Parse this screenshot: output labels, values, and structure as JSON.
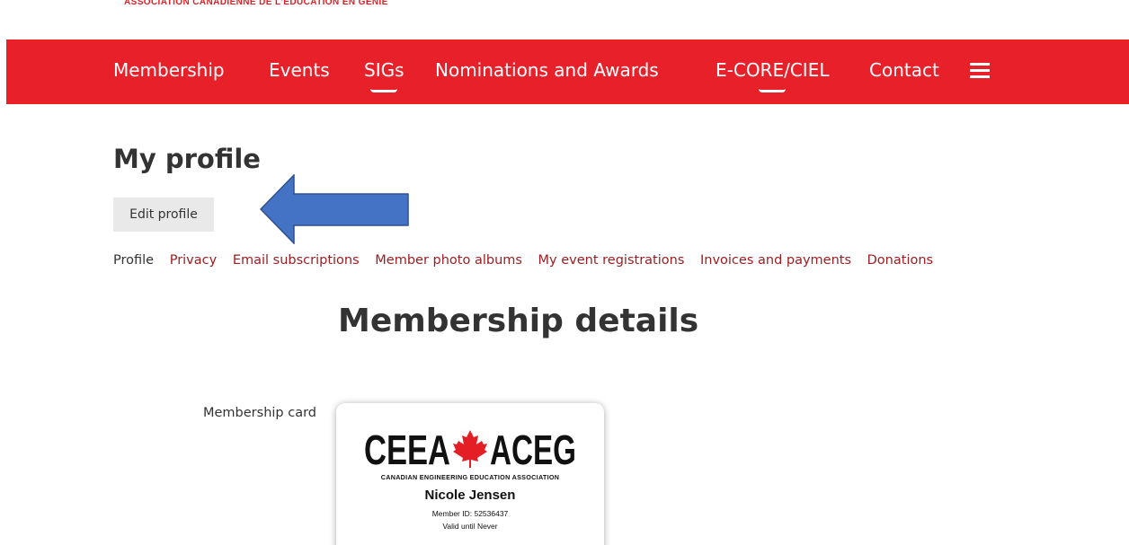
{
  "header": {
    "org_tagline": "ASSOCIATION CANADIENNE DE L'EDUCATION EN GENIE"
  },
  "nav": {
    "items": [
      {
        "label": "Membership",
        "active": false
      },
      {
        "label": "Events",
        "active": false
      },
      {
        "label": "SIGs",
        "active": true
      },
      {
        "label": "Nominations and Awards",
        "active": false
      },
      {
        "label": "E-CORE/CIEL",
        "active": true
      },
      {
        "label": "Contact",
        "active": false
      }
    ],
    "menu_icon": "hamburger-icon",
    "color": "#e8202a"
  },
  "profile": {
    "title": "My profile",
    "edit_button": "Edit profile",
    "annotation": "arrow-icon",
    "annotation_color": "#4472c4"
  },
  "subnav": {
    "current": "Profile",
    "links": [
      "Privacy",
      "Email subscriptions",
      "Member photo albums",
      "My event registrations",
      "Invoices and payments",
      "Donations"
    ],
    "link_color": "#9b1c1f"
  },
  "membership": {
    "title": "Membership details",
    "card_label": "Membership card",
    "card": {
      "logo_text": "CEEA ACEG",
      "logo_sub": "CANADIAN ENGINEERING EDUCATION ASSOCIATION",
      "member_name": "Nicole Jensen",
      "member_id": "Member ID: 52536437",
      "valid": "Valid until Never"
    }
  }
}
